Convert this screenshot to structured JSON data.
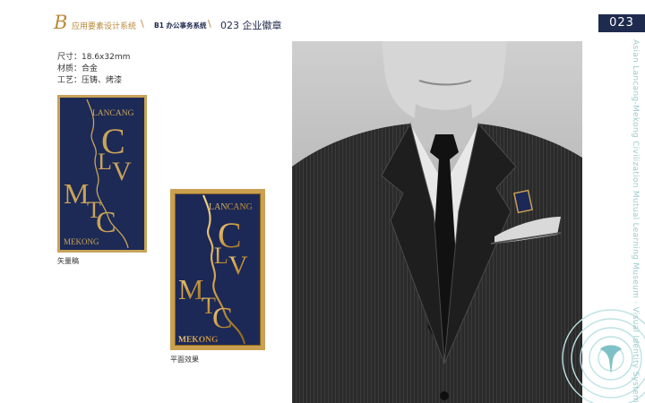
{
  "header": {
    "letter": "B",
    "system": "应用要素设计系统",
    "sep": "\\",
    "sub": "B1 办公事务系统",
    "title": "023 企业徽章",
    "page_number": "023"
  },
  "specs": {
    "size": "尺寸：18.6x32mm",
    "material": "材质：合金",
    "process": "工艺：压铸、烤漆"
  },
  "badge": {
    "top": "LANCANG",
    "bottom": "MEKONG",
    "c1": "C",
    "l": "L",
    "v": "V",
    "m": "M",
    "t": "T",
    "c2": "C"
  },
  "captions": {
    "vector": "矢量稿",
    "flat": "平面效果"
  },
  "vertical_text": "Asian Lancang-Mekong Civilization Mutual Learning Museum · Visual Identity System",
  "colors": {
    "navy": "#1f2a4f",
    "gold": "#b8893a",
    "teal": "#9ccbcf"
  }
}
